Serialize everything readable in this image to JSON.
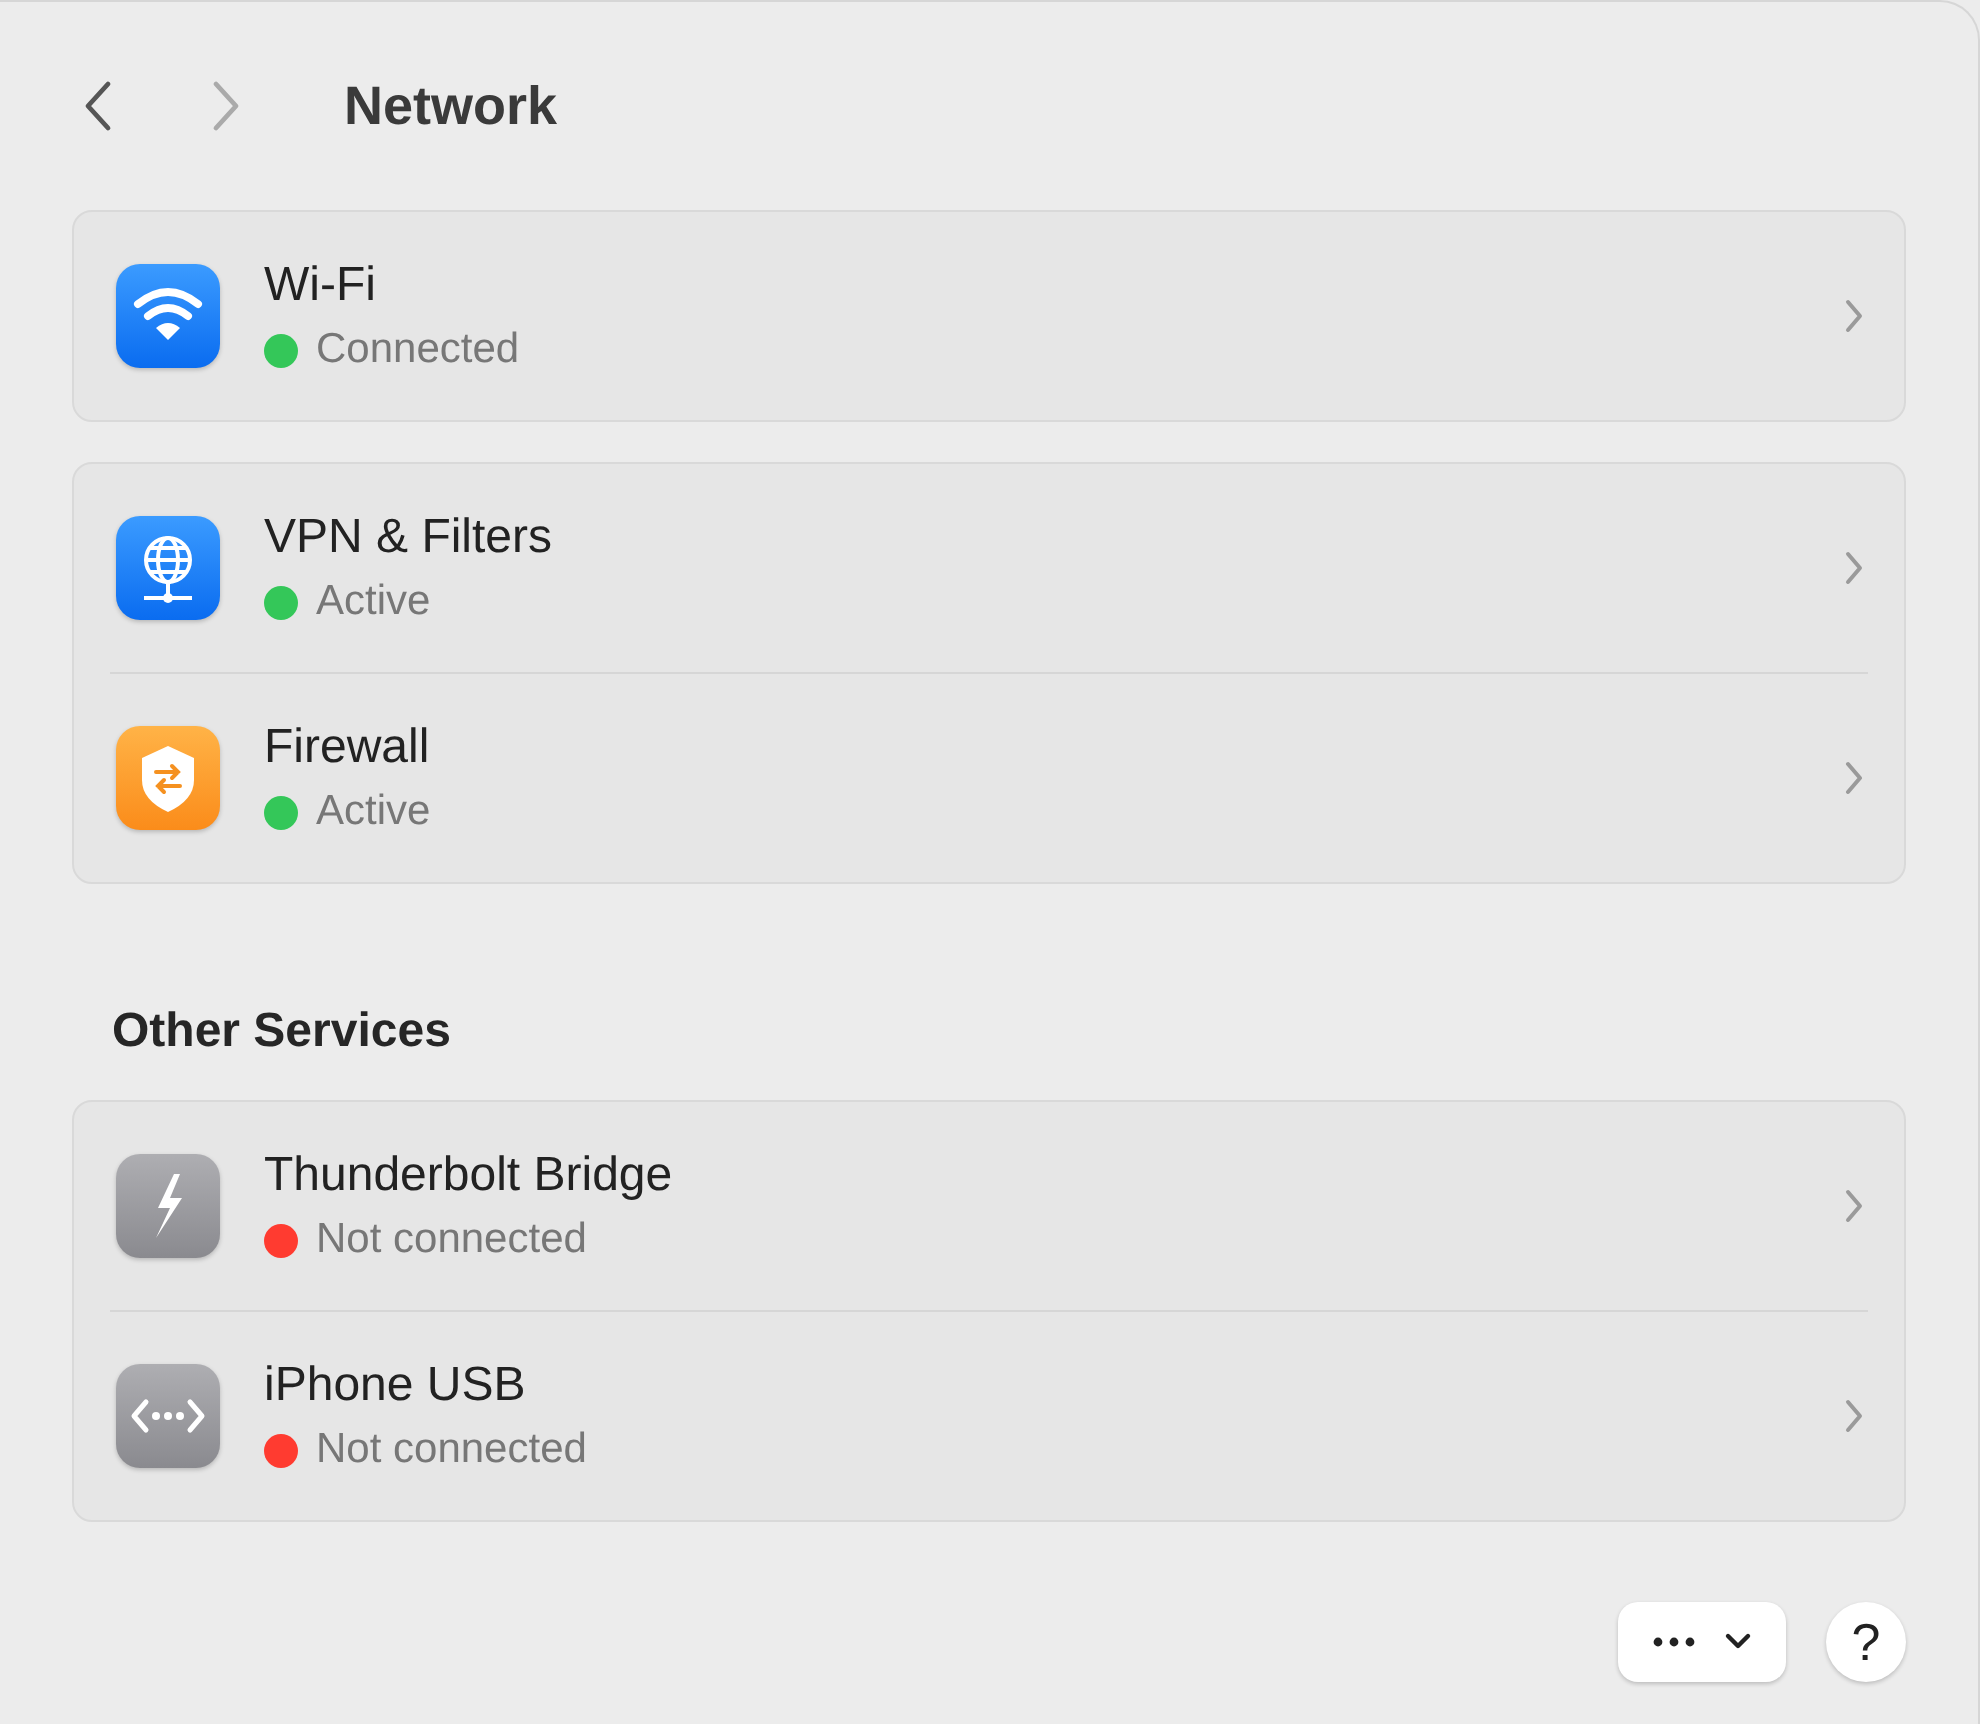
{
  "title": "Network",
  "groups": [
    {
      "items": [
        {
          "kind": "wifi",
          "name": "Wi-Fi",
          "status": "Connected",
          "color": "#34c759"
        }
      ]
    },
    {
      "items": [
        {
          "kind": "vpn",
          "name": "VPN & Filters",
          "status": "Active",
          "color": "#34c759"
        },
        {
          "kind": "firewall",
          "name": "Firewall",
          "status": "Active",
          "color": "#34c759"
        }
      ]
    },
    {
      "heading": "Other Services",
      "items": [
        {
          "kind": "thunderbolt",
          "name": "Thunderbolt Bridge",
          "status": "Not connected",
          "color": "#ff3b30"
        },
        {
          "kind": "usb",
          "name": "iPhone USB",
          "status": "Not connected",
          "color": "#ff3b30"
        }
      ]
    }
  ],
  "help": "?"
}
